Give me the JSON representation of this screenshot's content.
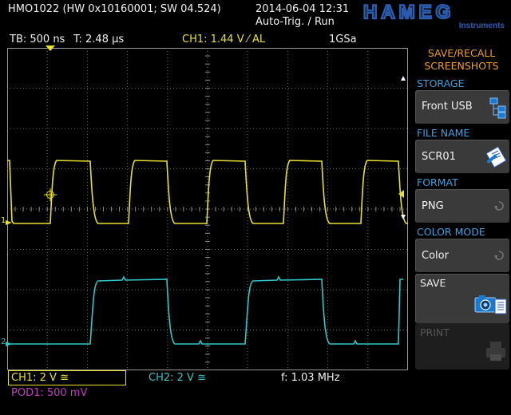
{
  "header": {
    "device_info": "HMO1022 (HW 0x10160001; SW 04.524)",
    "datetime": "2014-06-04 12:31",
    "trigger_status": "Auto-Trig. / Run",
    "brand": "HAMEG",
    "brand_sub": "Instruments"
  },
  "status_bar": {
    "timebase": "TB: 500 ns",
    "trigger_time": "T: 2.48 µs",
    "trigger_level": "CH1: 1.44 V ⁄ AL",
    "sample_rate": "1GSa"
  },
  "channel_markers": {
    "ch1": "1",
    "ch2": "2"
  },
  "footer": {
    "ch1_setting": "CH1: 2 V ≅",
    "ch2_setting": "CH2: 2 V ≅",
    "frequency": "f: 1.03 MHz",
    "pod1_setting": "POD1: 500 mV"
  },
  "menu": {
    "title_line1": "SAVE/RECALL",
    "title_line2": "SCREENSHOTS",
    "storage_label": "STORAGE",
    "storage_value": "Front USB",
    "filename_label": "FILE NAME",
    "filename_value": "SCR01",
    "format_label": "FORMAT",
    "format_value": "PNG",
    "colormode_label": "COLOR MODE",
    "colormode_value": "Color",
    "save_label": "SAVE",
    "print_label": "PRINT"
  },
  "colors": {
    "ch1_trace": "#e8e030",
    "ch2_trace": "#30c8c8",
    "pod1": "#c040c0",
    "menu_title": "#f0a020",
    "menu_label": "#40a0e0",
    "softkey_bg": "#3a3a3a",
    "brand": "#2a5cb0"
  },
  "waveforms": {
    "frequency_mhz": 1.03,
    "ch1_duty_cycle": 0.5,
    "ch2_duty_cycle": 0.5
  },
  "icons": {
    "storage": "usb-folders-icon",
    "filename": "edit-file-icon",
    "format": "rotate-arrow-icon",
    "colormode": "rotate-arrow-icon",
    "save": "camera-icon",
    "print": "printer-icon",
    "trigger_marker": "trigger-t-marker-icon",
    "cursor": "crosshair-icon"
  }
}
